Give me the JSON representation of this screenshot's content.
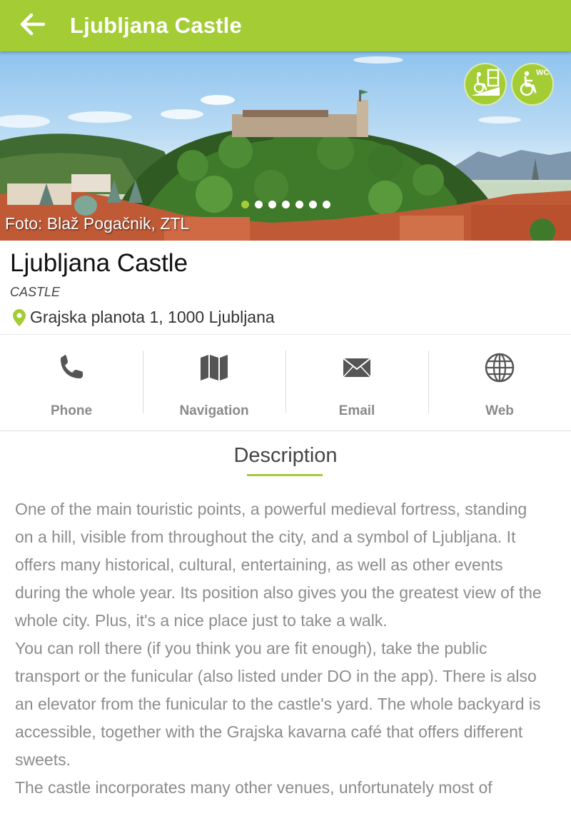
{
  "header": {
    "title": "Ljubljana Castle",
    "back_icon": "arrow-left-icon"
  },
  "colors": {
    "accent": "#a3cc35",
    "text_muted": "#8c8c8c"
  },
  "hero": {
    "photo_credit": "Foto: Blaž Pogačnik, ZTL",
    "badges": [
      {
        "icon": "wheelchair-ramp-icon"
      },
      {
        "icon": "accessible-wc-icon",
        "text": "WC"
      }
    ],
    "slide_count": 7,
    "active_slide": 1
  },
  "place": {
    "name": "Ljubljana Castle",
    "category": "CASTLE",
    "address": "Grajska planota 1, 1000 Ljubljana"
  },
  "actions": [
    {
      "label": "Phone",
      "icon": "phone-icon"
    },
    {
      "label": "Navigation",
      "icon": "map-icon"
    },
    {
      "label": "Email",
      "icon": "envelope-icon"
    },
    {
      "label": "Web",
      "icon": "globe-icon"
    }
  ],
  "description": {
    "heading": "Description",
    "paragraphs": [
      "One of the main touristic points, a powerful medieval fortress, standing on a hill, visible from throughout the city, and a symbol of Ljubljana. It offers many historical, cultural, entertaining, as well as other events during the whole year. Its position also gives you the greatest view of the whole city. Plus, it's a nice place just to take a walk.",
      "You can roll there (if you think you are fit enough), take the public transport or the funicular (also listed under DO in the app). There is also an elevator from the funicular to the castle's yard. The whole backyard is accessible, together with the Grajska kavarna café that offers different sweets.",
      "The castle incorporates many other venues, unfortunately most of"
    ]
  }
}
